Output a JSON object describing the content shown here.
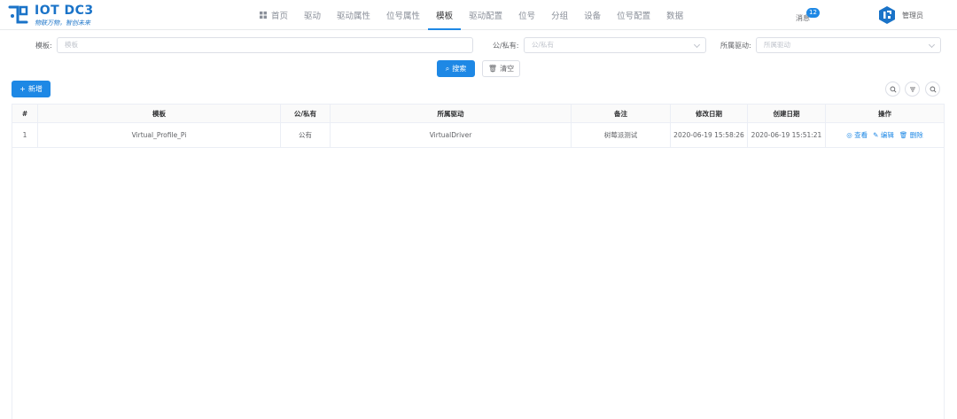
{
  "app": {
    "title": "IOT DC3",
    "slogan": "物联万物，智创未来"
  },
  "nav": {
    "items": [
      {
        "label": "首页",
        "icon": "grid-icon"
      },
      {
        "label": "驱动"
      },
      {
        "label": "驱动属性"
      },
      {
        "label": "位号属性"
      },
      {
        "label": "模板",
        "active": true
      },
      {
        "label": "驱动配置"
      },
      {
        "label": "位号"
      },
      {
        "label": "分组"
      },
      {
        "label": "设备"
      },
      {
        "label": "位号配置"
      },
      {
        "label": "数据"
      }
    ],
    "messages_label": "消息",
    "messages_count": "12",
    "user_name": "管理员"
  },
  "filters": {
    "template_label": "模板:",
    "template_placeholder": "模板",
    "access_label": "公/私有:",
    "access_placeholder": "公/私有",
    "driver_label": "所属驱动:",
    "driver_placeholder": "所属驱动"
  },
  "actions": {
    "search_label": "搜索",
    "clear_label": "清空",
    "add_label": "新增"
  },
  "table": {
    "columns": [
      "#",
      "模板",
      "公/私有",
      "所属驱动",
      "备注",
      "修改日期",
      "创建日期",
      "操作"
    ],
    "rows": [
      {
        "index": "1",
        "template": "Virtual_Profile_Pi",
        "access": "公有",
        "driver": "VirtualDriver",
        "remark": "树莓派测试",
        "modified": "2020-06-19 15:58:26",
        "created": "2020-06-19 15:51:21",
        "view_label": "查看",
        "edit_label": "编辑",
        "delete_label": "删除"
      }
    ]
  },
  "colors": {
    "accent": "#1e88e5",
    "brand": "#1a73c8"
  }
}
